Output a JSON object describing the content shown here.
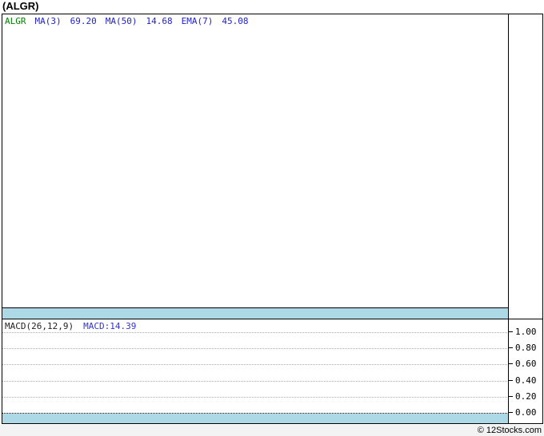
{
  "page": {
    "title": "(ALGR)",
    "footer": "© 12Stocks.com"
  },
  "price_panel": {
    "legend": {
      "symbol": "ALGR",
      "ma3_label": "MA(3)",
      "ma3_value": "69.20",
      "ma50_label": "MA(50)",
      "ma50_value": "14.68",
      "ema7_label": "EMA(7)",
      "ema7_value": "45.08"
    }
  },
  "macd_panel": {
    "indicator_label": "MACD(26,12,9)",
    "indicator_value": "MACD:14.39",
    "axis_ticks": [
      "1.00",
      "0.80",
      "0.60",
      "0.40",
      "0.20",
      "0.00"
    ]
  },
  "colors": {
    "symbol_text": "#008000",
    "indicator_text": "#2222cc",
    "macd_value_text": "#3333cc",
    "band_blue": "#add8e6",
    "grid_gray": "#aaaaaa",
    "border": "#000000",
    "footer_bg": "#f3f3f3"
  },
  "chart_data": [
    {
      "type": "line",
      "panel": "price",
      "title": "(ALGR)",
      "series": [
        {
          "name": "ALGR",
          "visible_points": []
        },
        {
          "name": "MA(3)",
          "last_value": 69.2,
          "visible_points": []
        },
        {
          "name": "MA(50)",
          "last_value": 14.68,
          "visible_points": []
        },
        {
          "name": "EMA(7)",
          "last_value": 45.08,
          "visible_points": []
        }
      ],
      "note": "plot area renders empty (no drawn series) in screenshot",
      "legend_position": "top-left",
      "grid": false
    },
    {
      "type": "line",
      "panel": "MACD(26,12,9)",
      "series": [
        {
          "name": "MACD",
          "last_value": 14.39,
          "visible_points": []
        }
      ],
      "ylim": [
        0.0,
        1.0
      ],
      "yticks": [
        1.0,
        0.8,
        0.6,
        0.4,
        0.2,
        0.0
      ],
      "grid": true,
      "zero_line": true,
      "axis_position": "right",
      "legend_position": "top-left"
    }
  ]
}
